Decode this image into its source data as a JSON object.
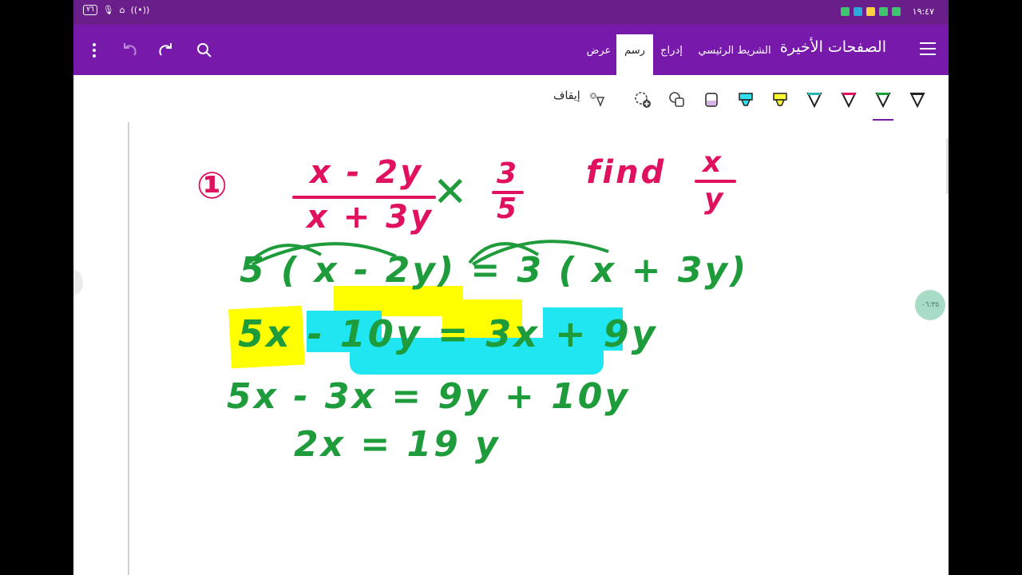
{
  "status_bar": {
    "time": "١٩:٤٧",
    "battery": "٧٦"
  },
  "app_bar": {
    "page_title": "الصفحات الأخيرة",
    "tabs": [
      {
        "label": "الشريط الرئيسي",
        "active": false
      },
      {
        "label": "إدراج",
        "active": false
      },
      {
        "label": "رسم",
        "active": true
      },
      {
        "label": "عرض",
        "active": false
      }
    ],
    "icons": [
      "hamburger-icon",
      "search-icon",
      "redo-icon",
      "undo-icon",
      "more-options-icon"
    ]
  },
  "ribbon": {
    "stop_label": "إيقاف",
    "tools": [
      {
        "name": "pen-black",
        "color": "#222222"
      },
      {
        "name": "pen-green",
        "color": "#1e9b3a"
      },
      {
        "name": "pen-pink",
        "color": "#e0115f"
      },
      {
        "name": "pen-teal",
        "color": "#2bb5b5"
      },
      {
        "name": "highlighter-yellow",
        "color": "#ffff33"
      },
      {
        "name": "highlighter-cyan",
        "color": "#33e0f0"
      },
      {
        "name": "highlighter-purple",
        "color": "#d8b4e6"
      },
      {
        "name": "shapes",
        "color": "#444444"
      },
      {
        "name": "lasso-add",
        "color": "#444444"
      }
    ]
  },
  "canvas": {
    "timestamp_bubble": "٠٦:٣٥",
    "ink": {
      "problem_number": "①",
      "numerator": "x - 2y",
      "denominator": "x + 3y",
      "cross_mark": "✕",
      "rhs_numerator": "3",
      "rhs_denominator": "5",
      "find_text": "find",
      "find_numerator": "x",
      "find_denominator": "y",
      "line1": "5 ( x - 2y) = 3 ( x + 3y)",
      "line2": "5x - 10y = 3x + 9y",
      "line3": "5x - 3x = 9y + 10y",
      "line4": "2x = 19 y"
    },
    "colors": {
      "pink_ink": "#e0115f",
      "green_ink": "#1e9b3a",
      "yellow_highlight": "#ffff00",
      "cyan_highlight": "#1fe6f0"
    }
  }
}
